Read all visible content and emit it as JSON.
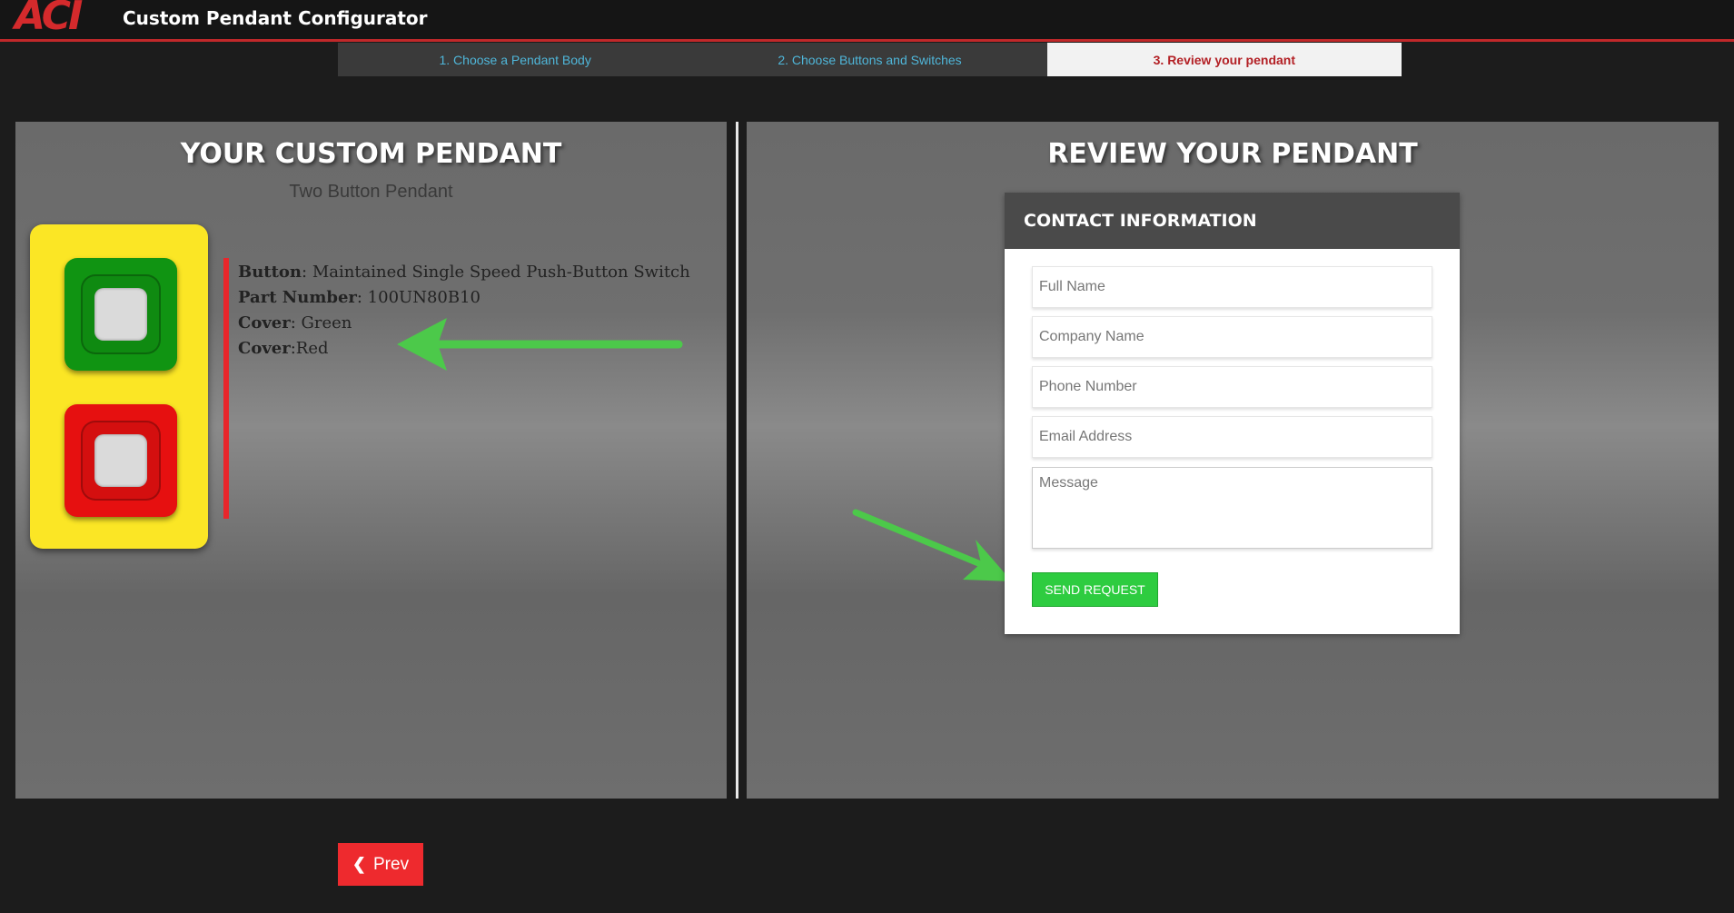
{
  "header": {
    "logo_text": "ACI",
    "title": "Custom Pendant Configurator"
  },
  "steps": [
    {
      "label": "1. Choose a Pendant Body"
    },
    {
      "label": "2. Choose Buttons and Switches"
    },
    {
      "label": "3. Review your pendant",
      "active": true
    }
  ],
  "left_panel": {
    "heading": "YOUR CUSTOM PENDANT",
    "subtitle": "Two Button Pendant",
    "specs": {
      "button_label": "Button",
      "button_value": ": Maintained Single Speed Push-Button Switch",
      "part_label": "Part Number",
      "part_value": ": 100UN80B10",
      "cover1_label": "Cover",
      "cover1_value": ": Green",
      "cover2_label": "Cover",
      "cover2_value": ":Red"
    },
    "pendant": {
      "body_color": "#fbe625",
      "button_colors": [
        "#109412",
        "#e61010"
      ]
    }
  },
  "right_panel": {
    "heading": "REVIEW YOUR PENDANT",
    "card_title": "CONTACT INFORMATION",
    "fields": {
      "full_name": "Full Name",
      "company_name": "Company Name",
      "phone_number": "Phone Number",
      "email_address": "Email Address",
      "message": "Message"
    },
    "send_label": "SEND REQUEST"
  },
  "footer": {
    "prev_label": "Prev",
    "prev_icon": "chevron-left-icon"
  },
  "colors": {
    "accent_red": "#ee2a2e",
    "step_link": "#4fb6d9",
    "send_green": "#2ecc40",
    "arrow_green": "#4cc94a"
  }
}
